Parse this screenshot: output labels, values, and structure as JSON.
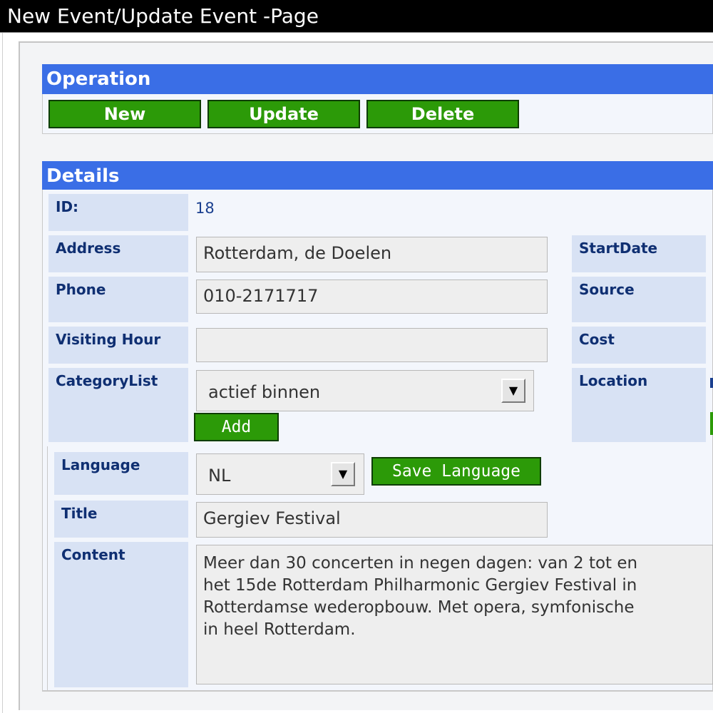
{
  "window": {
    "title": "New Event/Update Event -Page"
  },
  "operation": {
    "header": "Operation",
    "buttons": {
      "new": "New",
      "update": "Update",
      "delete": "Delete"
    }
  },
  "details": {
    "header": "Details",
    "id": {
      "label": "ID:",
      "value": "18"
    },
    "address": {
      "label": "Address",
      "value": "Rotterdam, de Doelen"
    },
    "phone": {
      "label": "Phone",
      "value": "010-2171717"
    },
    "visiting_hour": {
      "label": "Visiting Hour",
      "value": ""
    },
    "category_list": {
      "label": "CategoryList",
      "selected": "actief binnen",
      "add_label": "Add"
    },
    "right_labels": {
      "start_date": "StartDate",
      "source": "Source",
      "cost": "Cost",
      "location": "Location"
    },
    "language": {
      "label": "Language",
      "selected": "NL",
      "save_label": "Save Language"
    },
    "title": {
      "label": "Title",
      "value": "Gergiev Festival"
    },
    "content": {
      "label": "Content",
      "lines": [
        "Meer dan 30 concerten in negen dagen: van 2 tot en",
        "het 15de Rotterdam Philharmonic Gergiev Festival in",
        "Rotterdamse wederopbouw. Met opera, symfonische",
        "in heel Rotterdam."
      ]
    }
  },
  "colors": {
    "section_header": "#3a6ee6",
    "button_green": "#2c9a08",
    "label_bg": "#d8e2f4",
    "label_text": "#0f2f72",
    "title_bar": "#000000"
  }
}
